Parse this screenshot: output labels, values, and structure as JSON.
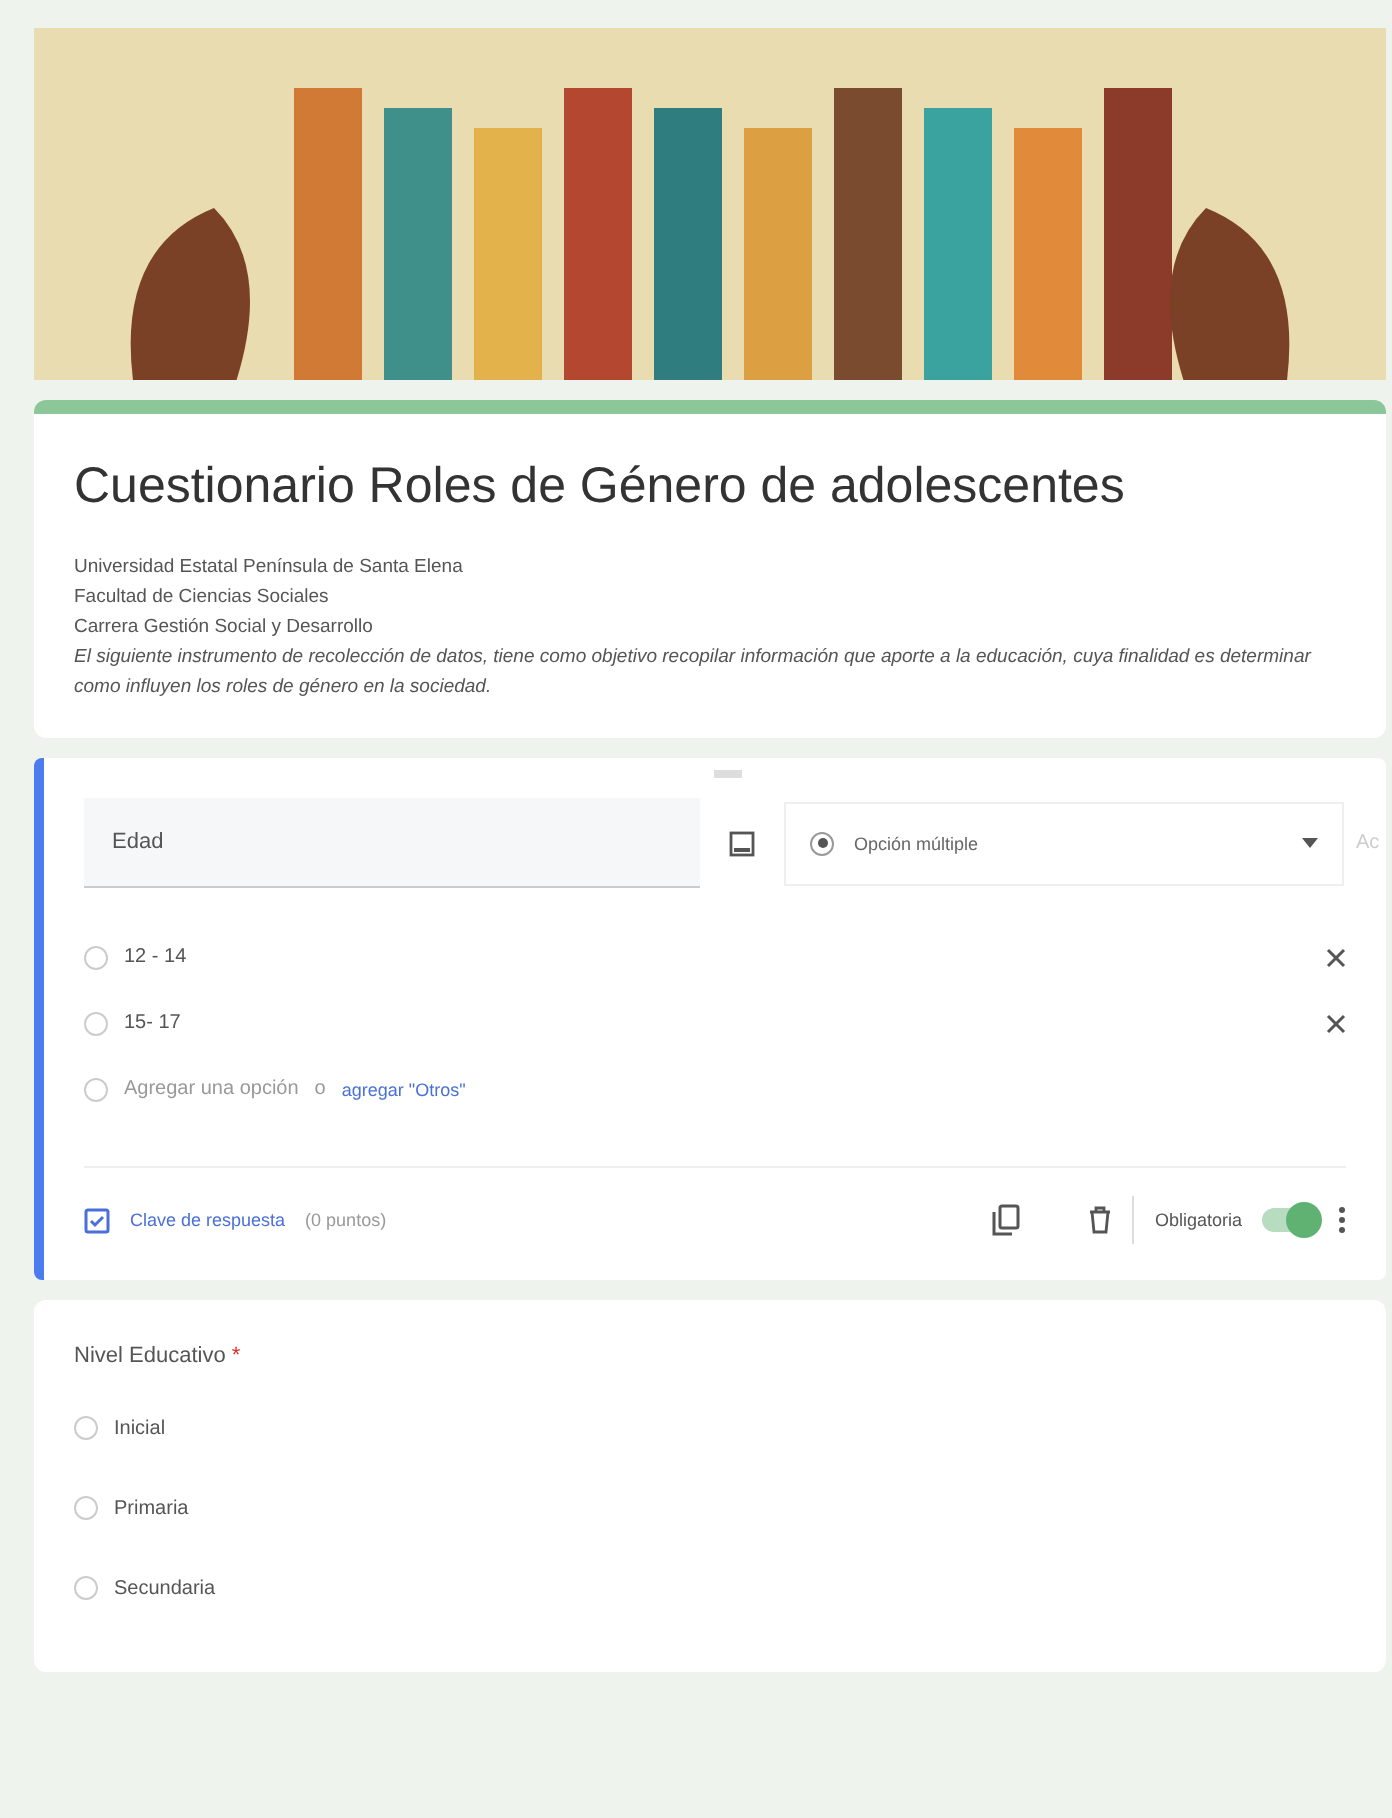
{
  "form": {
    "title": "Cuestionario Roles de Género de adolescentes",
    "description_lines": [
      "Universidad Estatal Península de Santa Elena",
      "Facultad de Ciencias Sociales",
      "Carrera Gestión Social y Desarrollo"
    ],
    "description_italic": "El siguiente instrumento de recolección de datos, tiene como objetivo recopilar información que aporte a la educación, cuya finalidad es determinar como influyen los roles de género en la sociedad."
  },
  "edited_question": {
    "title": "Edad",
    "type": "Opción múltiple",
    "side_text": "Ac",
    "options": [
      {
        "label": "12 - 14",
        "selected": false
      },
      {
        "label": "15-  17",
        "selected": false
      }
    ],
    "add_option": "Agregar una opción",
    "add_option_sep": "o",
    "add_other": "agregar \"Otros\"",
    "answer_key": "Clave de respuesta",
    "points": "(0 puntos)",
    "required_label": "Obligatoria",
    "required_on": true
  },
  "question": {
    "title": "Nivel Educativo",
    "required_mark": "*",
    "options": [
      {
        "label": "Inicial",
        "selected": false
      },
      {
        "label": "Primaria",
        "selected": false
      },
      {
        "label": "Secundaria",
        "selected": false
      }
    ]
  }
}
